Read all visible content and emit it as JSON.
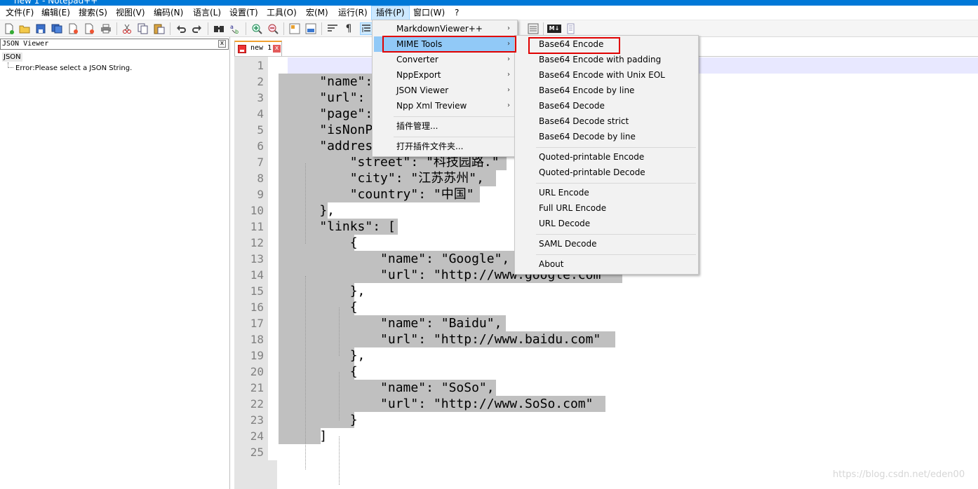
{
  "window": {
    "title": "new 1 - Notepad++"
  },
  "menubar": [
    {
      "label": "文件(F)"
    },
    {
      "label": "编辑(E)"
    },
    {
      "label": "搜索(S)"
    },
    {
      "label": "视图(V)"
    },
    {
      "label": "编码(N)"
    },
    {
      "label": "语言(L)"
    },
    {
      "label": "设置(T)"
    },
    {
      "label": "工具(O)"
    },
    {
      "label": "宏(M)"
    },
    {
      "label": "运行(R)"
    },
    {
      "label": "插件(P)"
    },
    {
      "label": "窗口(W)"
    },
    {
      "label": "?"
    }
  ],
  "toolbar": {
    "md_badge": "M↓",
    "pilcrow": "¶"
  },
  "json_viewer": {
    "title": "JSON Viewer",
    "close": "x",
    "root": "JSON",
    "error": "Error:Please select a JSON String."
  },
  "tab": {
    "label": "new 1",
    "close": "x"
  },
  "editor": {
    "line_numbers": [
      "1",
      "2",
      "3",
      "4",
      "5",
      "6",
      "7",
      "8",
      "9",
      "10",
      "11",
      "12",
      "13",
      "14",
      "15",
      "16",
      "17",
      "18",
      "19",
      "20",
      "21",
      "22",
      "23",
      "24",
      "25"
    ],
    "lines": [
      "",
      "    \"name\": ",
      "    \"url\": \"",
      "    \"page\": ",
      "    \"isNonPr",
      "    \"address",
      "        \"street\": \"科技园路.\"",
      "        \"city\": \"江苏苏州\",",
      "        \"country\": \"中国\"",
      "    },",
      "    \"links\": [",
      "        {",
      "            \"name\": \"Google\",",
      "            \"url\": \"http://www.google.com\"",
      "        },",
      "        {",
      "            \"name\": \"Baidu\",",
      "            \"url\": \"http://www.baidu.com\"",
      "        },",
      "        {",
      "            \"name\": \"SoSo\",",
      "            \"url\": \"http://www.SoSo.com\"",
      "        }",
      "    ]",
      ""
    ]
  },
  "plugins_menu": [
    {
      "label": "MarkdownViewer++",
      "submenu": true
    },
    {
      "label": "MIME Tools",
      "submenu": true,
      "highlighted": true
    },
    {
      "label": "Converter",
      "submenu": true
    },
    {
      "label": "NppExport",
      "submenu": true
    },
    {
      "label": "JSON Viewer",
      "submenu": true
    },
    {
      "label": "Npp Xml Treview",
      "submenu": true
    },
    {
      "label": "插件管理..."
    },
    {
      "label": "打开插件文件夹..."
    }
  ],
  "mime_tools_menu": [
    {
      "label": "Base64 Encode"
    },
    {
      "label": "Base64 Encode with padding"
    },
    {
      "label": "Base64 Encode with Unix EOL"
    },
    {
      "label": "Base64 Encode by line"
    },
    {
      "label": "Base64 Decode"
    },
    {
      "label": "Base64 Decode strict"
    },
    {
      "label": "Base64 Decode by line"
    },
    {
      "label": "Quoted-printable Encode"
    },
    {
      "label": "Quoted-printable Decode"
    },
    {
      "label": "URL Encode"
    },
    {
      "label": "Full URL Encode"
    },
    {
      "label": "URL Decode"
    },
    {
      "label": "SAML Decode"
    },
    {
      "label": "About"
    }
  ],
  "arrow_glyph": "›",
  "watermark": "https://blog.csdn.net/eden00",
  "colors": {
    "highlight": "#91c9f7",
    "selection": "#c0c0c0",
    "annotation": "#e00000",
    "current_line": "#e8e8ff"
  }
}
